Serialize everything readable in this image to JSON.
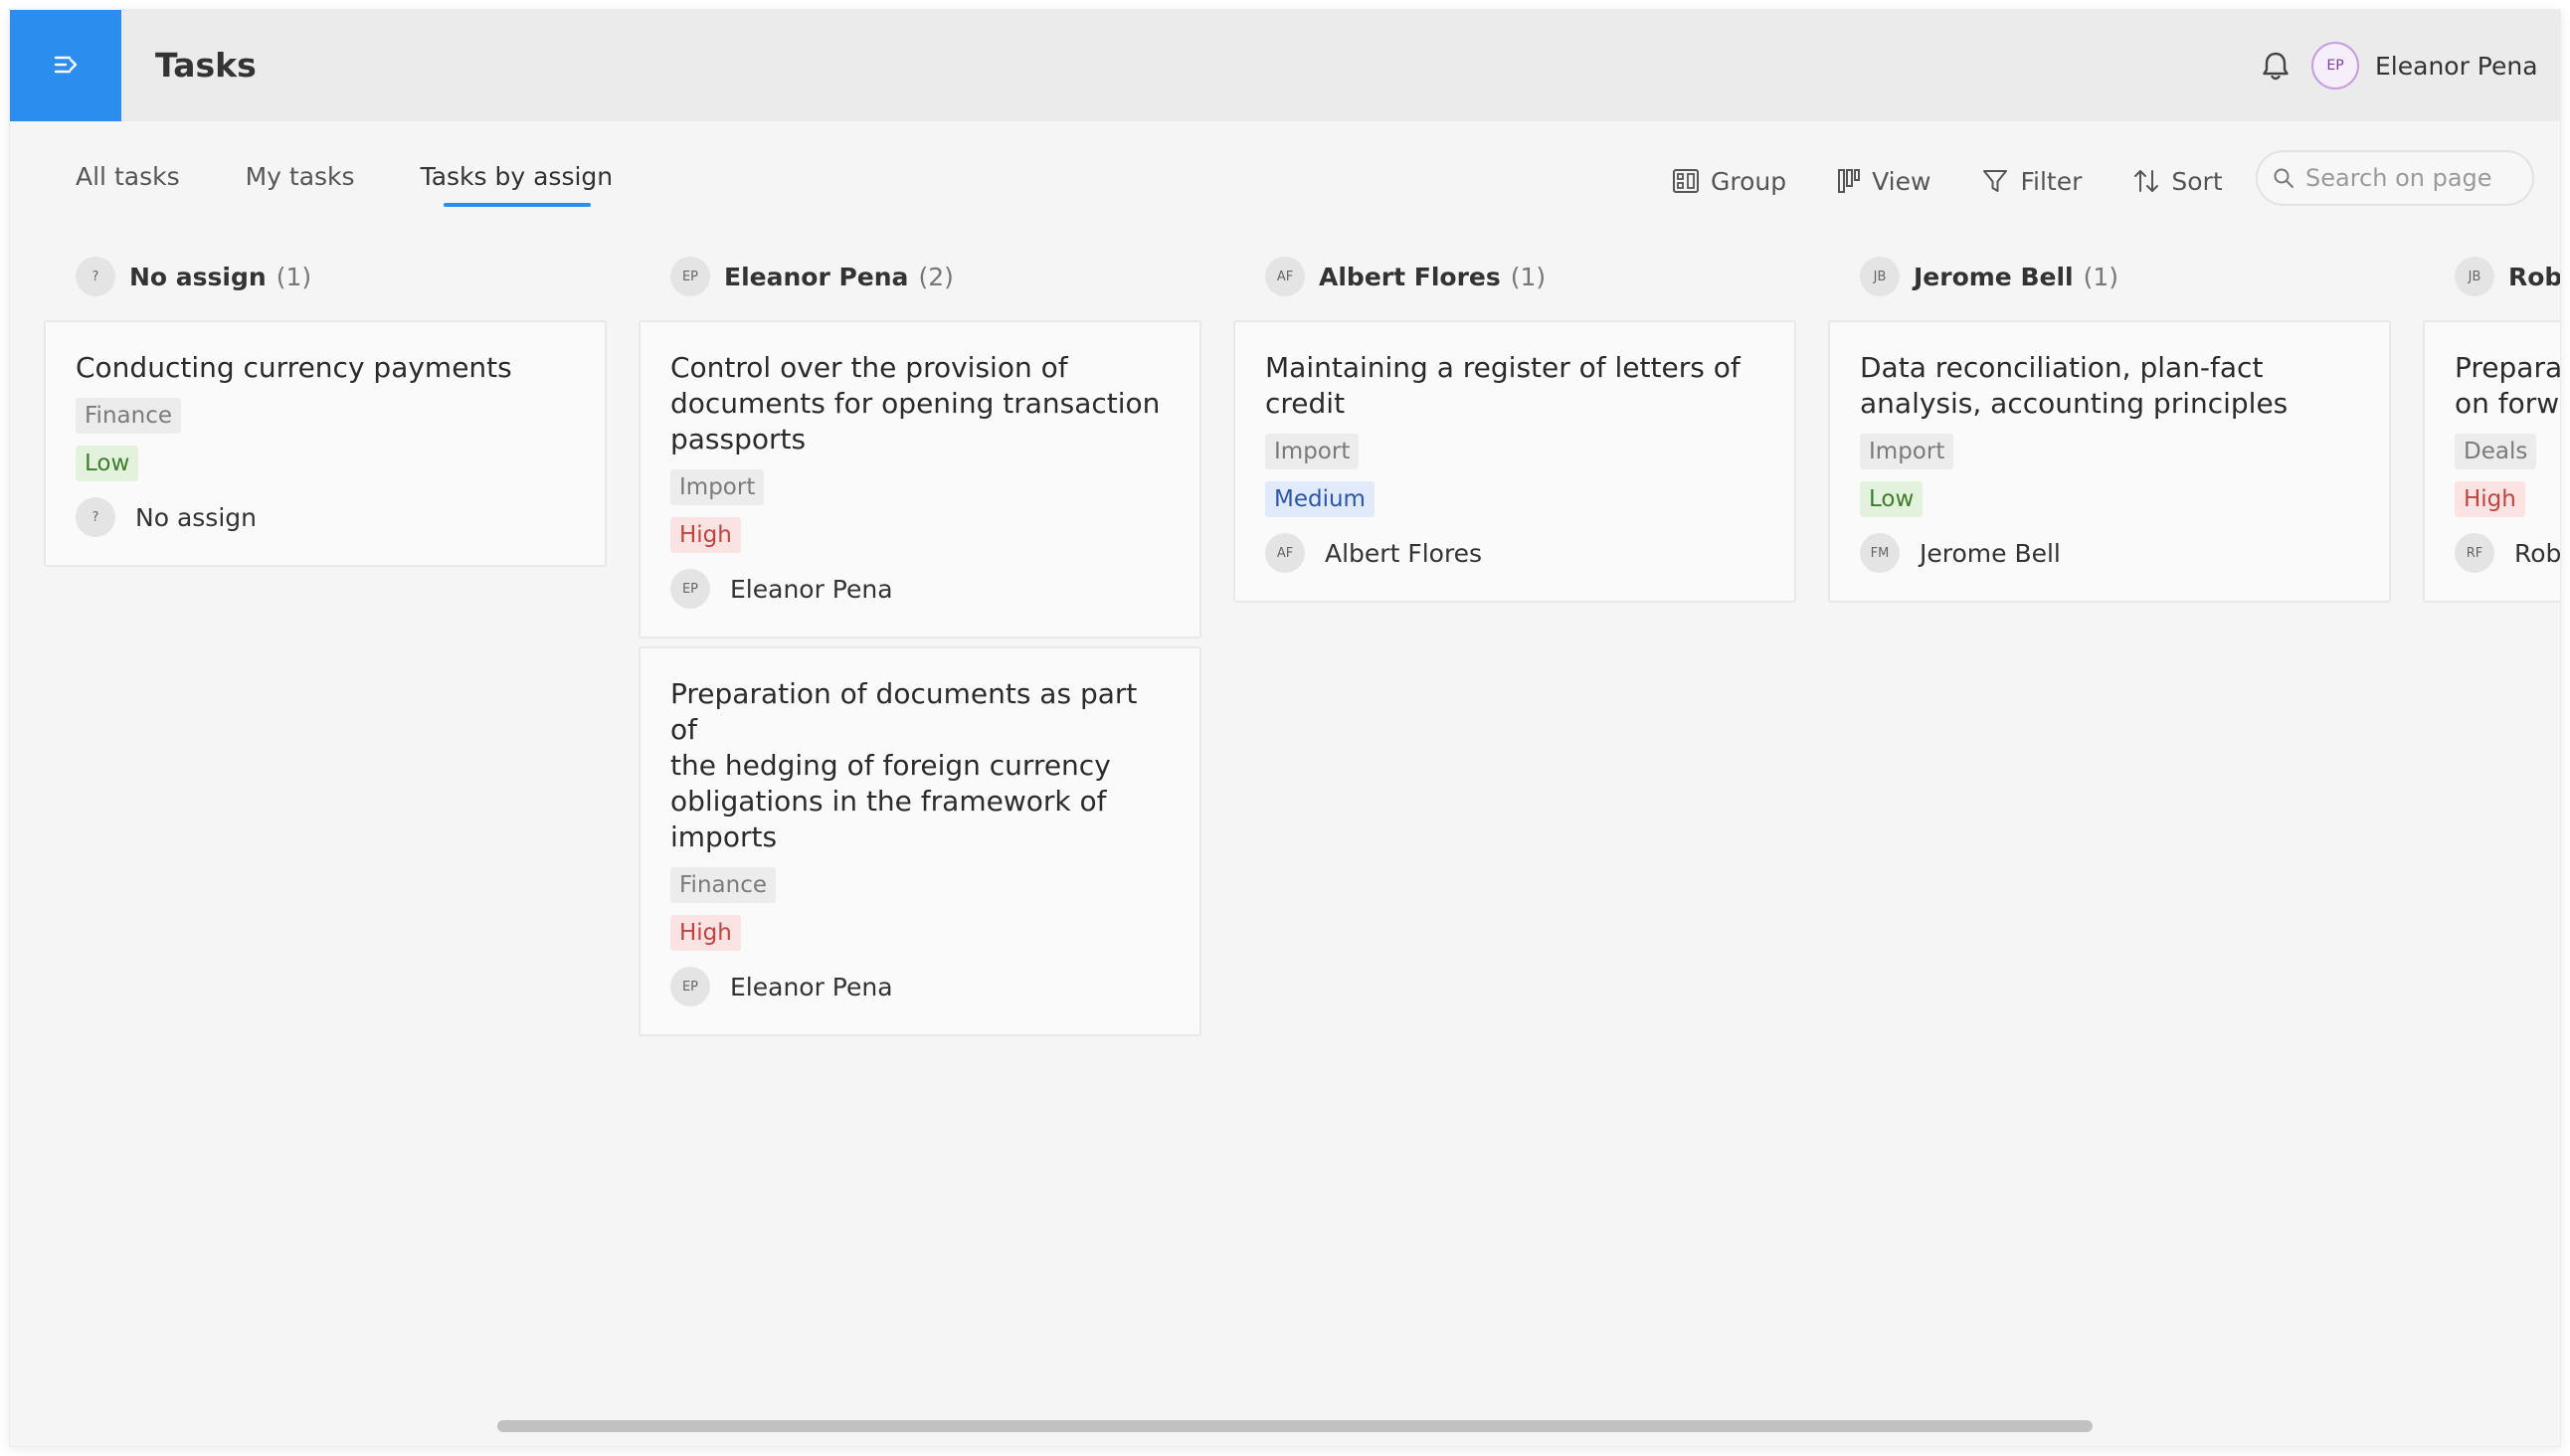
{
  "header": {
    "title": "Tasks",
    "menu_icon": "menu-expand-icon",
    "notifications_icon": "bell-icon",
    "user": {
      "initials": "EP",
      "name": "Eleanor Pena"
    }
  },
  "tabs": [
    {
      "label": "All tasks",
      "active": false
    },
    {
      "label": "My tasks",
      "active": false
    },
    {
      "label": "Tasks by assign",
      "active": true
    }
  ],
  "toolbar": {
    "group_label": "Group",
    "view_label": "View",
    "filter_label": "Filter",
    "sort_label": "Sort",
    "search_placeholder": "Search on page"
  },
  "colors": {
    "accent": "#2b8ded",
    "low": "#3d7d2b",
    "medium": "#2d56a8",
    "high": "#c0453f"
  },
  "columns": [
    {
      "initials": "?",
      "name": "No assign",
      "count": "(1)",
      "cards": [
        {
          "title": "Conducting currency payments",
          "category": "Finance",
          "priority": "Low",
          "assignee_initials": "?",
          "assignee": "No assign"
        }
      ]
    },
    {
      "initials": "EP",
      "name": "Eleanor Pena",
      "count": "(2)",
      "cards": [
        {
          "title": "Control over the provision of\ndocuments for opening transaction\npassports",
          "category": "Import",
          "priority": "High",
          "assignee_initials": "EP",
          "assignee": "Eleanor Pena"
        },
        {
          "title": "Preparation of documents as part of\nthe hedging of foreign currency\nobligations in the framework of\nimports",
          "category": "Finance",
          "priority": "High",
          "assignee_initials": "EP",
          "assignee": "Eleanor Pena"
        }
      ]
    },
    {
      "initials": "AF",
      "name": "Albert Flores",
      "count": "(1)",
      "cards": [
        {
          "title": "Maintaining a register of letters of\ncredit",
          "category": "Import",
          "priority": "Medium",
          "assignee_initials": "AF",
          "assignee": "Albert Flores"
        }
      ]
    },
    {
      "initials": "JB",
      "name": "Jerome Bell",
      "count": "(1)",
      "cards": [
        {
          "title": "Data reconciliation, plan-fact\nanalysis, accounting principles",
          "category": "Import",
          "priority": "Low",
          "assignee_initials": "FM",
          "assignee": "Jerome Bell"
        }
      ]
    },
    {
      "initials": "JB",
      "name": "Rob",
      "count": "",
      "cards": [
        {
          "title": "Prepara\non forw",
          "category": "Deals",
          "priority": "High",
          "assignee_initials": "RF",
          "assignee": "Rob"
        }
      ]
    }
  ]
}
